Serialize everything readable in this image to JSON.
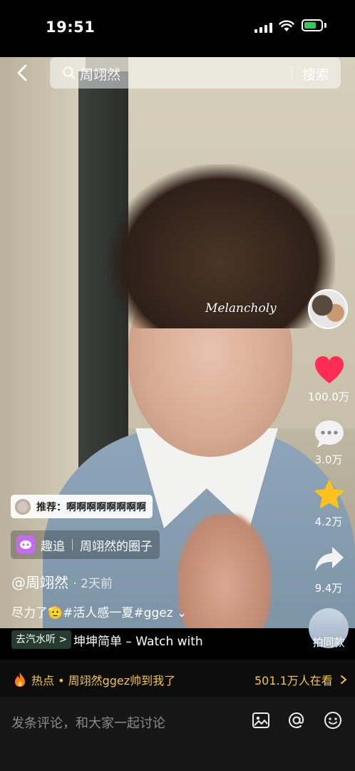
{
  "status_bar": {
    "time": "19:51"
  },
  "search": {
    "query": "周翊然",
    "button": "搜索"
  },
  "video": {
    "overlay_text": "Melancholy"
  },
  "rail": {
    "likes": "100.0万",
    "comments": "3.0万",
    "favorites": "4.2万",
    "shares": "9.4万",
    "shoot_same": "拍同款"
  },
  "recommend": {
    "label": "推荐：啊啊啊啊啊啊啊啊"
  },
  "circle": {
    "app": "趣追",
    "name": "周翊然的圈子"
  },
  "post": {
    "author": "@周翊然",
    "time": "2天前",
    "caption": "尽力了🫡#活人感一夏#ggez ⌄"
  },
  "music": {
    "tag": "去汽水听 >",
    "text": "坤坤简单 – Watch with"
  },
  "hot": {
    "left": "热点 • 周翊然ggez帅到我了",
    "right": "501.1万人在看"
  },
  "comment_bar": {
    "placeholder": "发条评论，和大家一起讨论"
  },
  "colors": {
    "like": "#ff2d55",
    "favorite": "#ffc21c",
    "hot": "#f5c63c"
  }
}
